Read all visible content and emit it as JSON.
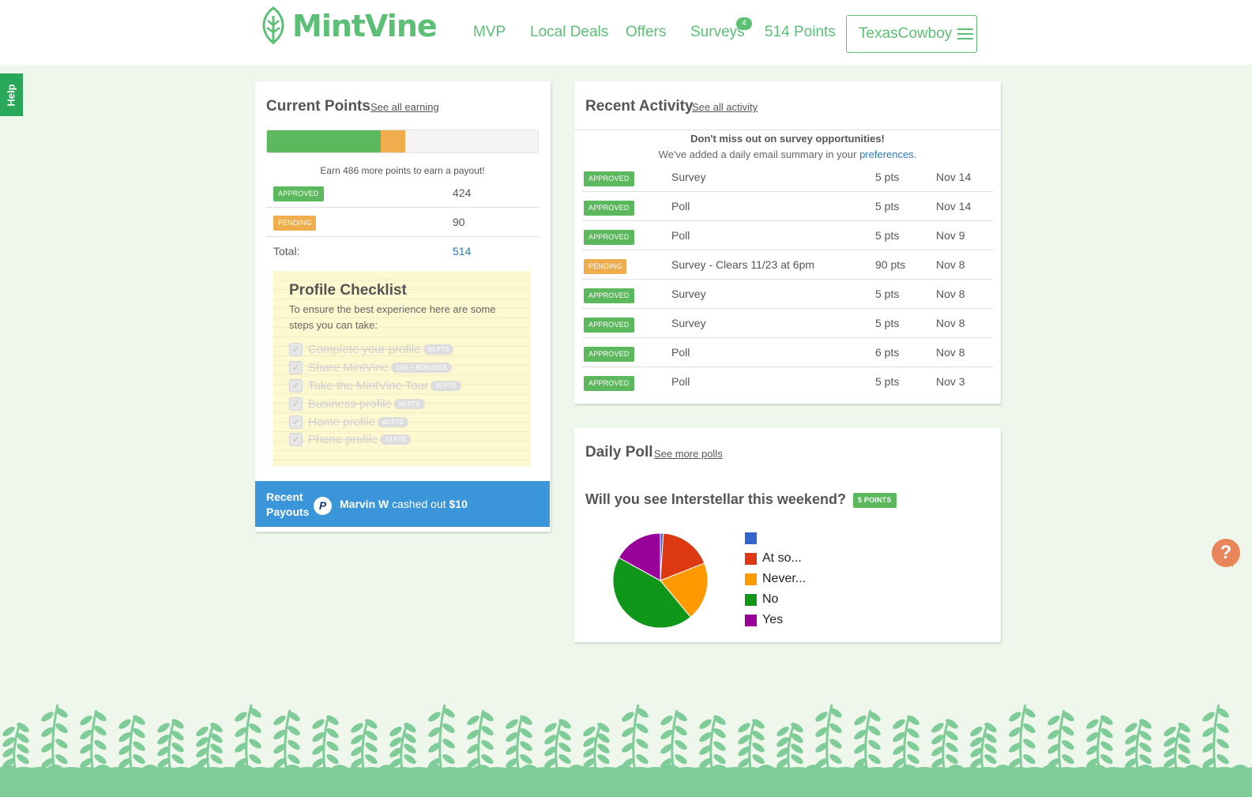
{
  "brand": {
    "name": "MintVine",
    "color": "#5cbf76"
  },
  "nav": {
    "items": [
      {
        "label": "MVP"
      },
      {
        "label": "Local Deals"
      },
      {
        "label": "Offers"
      },
      {
        "label": "Surveys",
        "badge": "4"
      },
      {
        "label": "514 Points"
      }
    ],
    "user": "TexasCowboy"
  },
  "help_tab": "Help",
  "current_points": {
    "title": "Current Points",
    "link": "See all earning",
    "progress": {
      "approved_fraction": 0.42,
      "pending_fraction": 0.09
    },
    "earn_text": "Earn 486 more points to earn a payout!",
    "rows": [
      {
        "label": "APPROVED",
        "value": "424"
      },
      {
        "label": "PENDING",
        "value": "90"
      }
    ],
    "total_label": "Total:",
    "total_value": "514"
  },
  "checklist": {
    "title": "Profile Checklist",
    "description": "To ensure the best experience here are some steps you can take:",
    "items": [
      {
        "text": "Complete your profile",
        "pts": "50 PTS"
      },
      {
        "text": "Share MintVine",
        "pts": "15% + BONUSES"
      },
      {
        "text": "Take the MintVine Tour",
        "pts": "10 PTS"
      },
      {
        "text": "Business profile",
        "pts": "50 PTS"
      },
      {
        "text": "Home profile",
        "pts": "40 PTS"
      },
      {
        "text": "Phone profile",
        "pts": "10 PTS"
      }
    ]
  },
  "payouts": {
    "label": "Recent Payouts",
    "icon": "paypal-icon",
    "icon_glyph": "P",
    "name": "Marvin W",
    "text": "cashed out",
    "amount": "$10"
  },
  "recent_activity": {
    "title": "Recent Activity",
    "link": "See all activity",
    "notice_bold": "Don't miss out on survey opportunities!",
    "notice_text": "We've added a daily email summary in your",
    "notice_link": "preferences.",
    "rows": [
      {
        "status": "APPROVED",
        "desc": "Survey",
        "pts": "5 pts",
        "date": "Nov 14"
      },
      {
        "status": "APPROVED",
        "desc": "Poll",
        "pts": "5 pts",
        "date": "Nov 14"
      },
      {
        "status": "APPROVED",
        "desc": "Poll",
        "pts": "5 pts",
        "date": "Nov 9"
      },
      {
        "status": "PENDING",
        "desc": "Survey - Clears 11/23 at 6pm",
        "pts": "90 pts",
        "date": "Nov 8"
      },
      {
        "status": "APPROVED",
        "desc": "Survey",
        "pts": "5 pts",
        "date": "Nov 8"
      },
      {
        "status": "APPROVED",
        "desc": "Survey",
        "pts": "5 pts",
        "date": "Nov 8"
      },
      {
        "status": "APPROVED",
        "desc": "Poll",
        "pts": "6 pts",
        "date": "Nov 8"
      },
      {
        "status": "APPROVED",
        "desc": "Poll",
        "pts": "5 pts",
        "date": "Nov 3"
      }
    ]
  },
  "daily_poll": {
    "title": "Daily Poll",
    "link": "See more polls",
    "question": "Will you see Interstellar this weekend?",
    "points_badge": "5 POINTS"
  },
  "chart_data": {
    "type": "pie",
    "categories": [
      "",
      "At so...",
      "Never...",
      "No",
      "Yes"
    ],
    "values": [
      1,
      18,
      20,
      44,
      17
    ],
    "colors": [
      "#3366cc",
      "#dc3912",
      "#ff9900",
      "#109618",
      "#990099"
    ],
    "legend": "right"
  },
  "help_bubble": "?"
}
